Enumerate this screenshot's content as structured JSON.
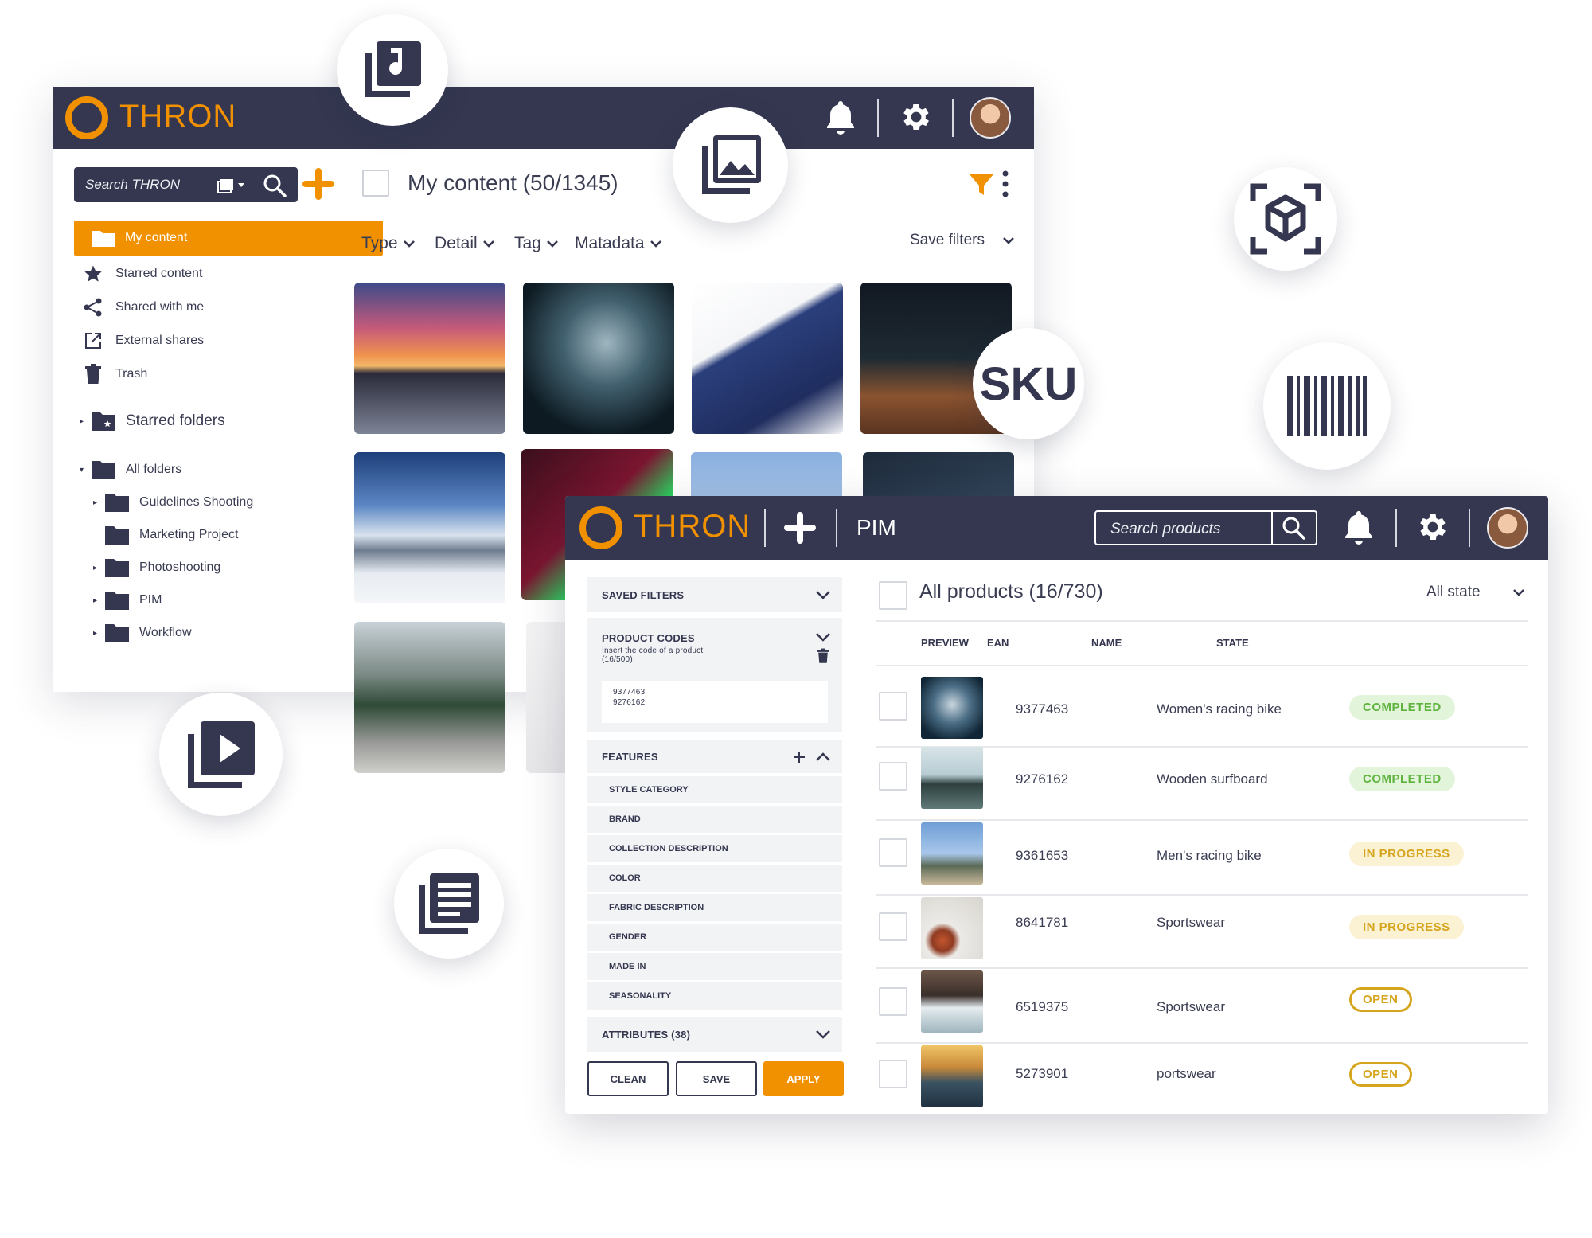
{
  "colors": {
    "navy": "#34374f",
    "orange": "#f29100",
    "completed": "#5fb33f",
    "in_progress": "#d6a51e"
  },
  "dam": {
    "logo_text": "THRON",
    "search_placeholder": "Search THRON",
    "header_title": "My content (50/1345)",
    "sidebar": {
      "items": [
        {
          "label": "My content",
          "icon": "folder-icon"
        },
        {
          "label": "Starred content",
          "icon": "star-icon"
        },
        {
          "label": "Shared with me",
          "icon": "share-icon"
        },
        {
          "label": "External shares",
          "icon": "external-link-icon"
        },
        {
          "label": "Trash",
          "icon": "trash-icon"
        }
      ],
      "starred_folders": "Starred folders",
      "all_folders": "All folders",
      "folders": [
        "Guidelines Shooting",
        "Marketing Project",
        "Photoshooting",
        "PIM",
        "Workflow"
      ]
    },
    "filters": [
      "Type",
      "Detail",
      "Tag",
      "Matadata"
    ],
    "save_filters": "Save filters"
  },
  "sku_label": "SKU",
  "pim": {
    "logo_text": "THRON",
    "section": "PIM",
    "search_placeholder": "Search products",
    "panel": {
      "saved_filters": "SAVED FILTERS",
      "product_codes": "PRODUCT CODES",
      "product_codes_hint": "Insert the code of a product",
      "product_codes_count": "(16/500)",
      "codes": [
        "9377463",
        "9276162"
      ],
      "features": "FEATURES",
      "feature_items": [
        "STYLE CATEGORY",
        "BRAND",
        "COLLECTION DESCRIPTION",
        "COLOR",
        "FABRIC DESCRIPTION",
        "GENDER",
        "MADE IN",
        "SEASONALITY"
      ],
      "attributes": "ATTRIBUTES (38)"
    },
    "buttons": {
      "clean": "CLEAN",
      "save": "SAVE",
      "apply": "APPLY"
    },
    "list_title": "All products (16/730)",
    "state_filter": "All state",
    "columns": [
      "PREVIEW",
      "EAN",
      "NAME",
      "STATE"
    ],
    "rows": [
      {
        "ean": "9377463",
        "name": "Women's racing bike",
        "state": "COMPLETED"
      },
      {
        "ean": "9276162",
        "name": "Wooden surfboard",
        "state": "COMPLETED"
      },
      {
        "ean": "9361653",
        "name": "Men's racing bike",
        "state": "IN PROGRESS"
      },
      {
        "ean": "8641781",
        "name": "Sportswear",
        "state": "IN PROGRESS"
      },
      {
        "ean": "6519375",
        "name": "Sportswear",
        "state": "OPEN"
      },
      {
        "ean": "5273901",
        "name": "portswear",
        "state": "OPEN"
      }
    ]
  }
}
